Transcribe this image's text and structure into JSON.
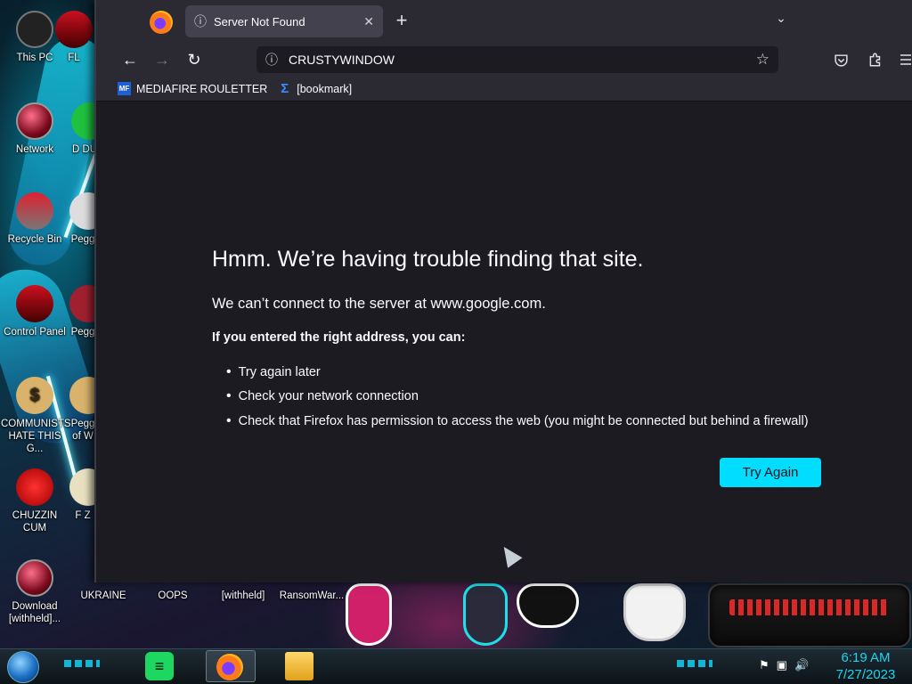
{
  "desktop": {
    "icons": [
      {
        "label": "This PC"
      },
      {
        "label": "FL"
      },
      {
        "label": "Network"
      },
      {
        "label": "D DU"
      },
      {
        "label": "Recycle Bin"
      },
      {
        "label": "Pegg"
      },
      {
        "label": "Control Panel"
      },
      {
        "label": "Pegg"
      },
      {
        "label": "COMMUNISTS HATE THIS G..."
      },
      {
        "label": "Pegg of W"
      },
      {
        "label": "CHUZZIN CUM"
      },
      {
        "label": "F Z"
      },
      {
        "label": "Download [withheld]..."
      },
      {
        "label": "UKRAINE"
      },
      {
        "label": "OOPS"
      },
      {
        "label": "[withheld]"
      },
      {
        "label": "RansomWar..."
      }
    ]
  },
  "browser": {
    "tab": {
      "title": "Server Not Found",
      "close": "✕"
    },
    "new_tab": "+",
    "tab_list": "⌄",
    "nav": {
      "back": "←",
      "forward": "→",
      "reload": "↻"
    },
    "url": "CRUSTYWINDOW",
    "bookmarks": [
      {
        "label": "MEDIAFIRE ROULETTER",
        "icon": "mediafire-icon"
      },
      {
        "label": "[bookmark]",
        "icon": "sigma-icon"
      }
    ],
    "toolbar_icons": [
      "pocket-icon",
      "extensions-icon",
      "menu-icon"
    ],
    "error": {
      "title": "Hmm. We’re having trouble finding that site.",
      "subtitle": "We can’t connect to the server at www.google.com.",
      "hint": "If you entered the right address, you can:",
      "items": [
        "Try again later",
        "Check your network connection",
        "Check that Firefox has permission to access the web (you might be connected but behind a firewall)"
      ],
      "button": "Try Again"
    }
  },
  "taskbar": {
    "apps": [
      "spotify-icon",
      "firefox-icon",
      "file-explorer-icon"
    ],
    "clock": {
      "time": "6:19 AM",
      "date": "7/27/2023"
    }
  },
  "colors": {
    "accent": "#00ddff",
    "page_bg": "#1c1b22",
    "chrome_bg": "#2b2a33"
  }
}
